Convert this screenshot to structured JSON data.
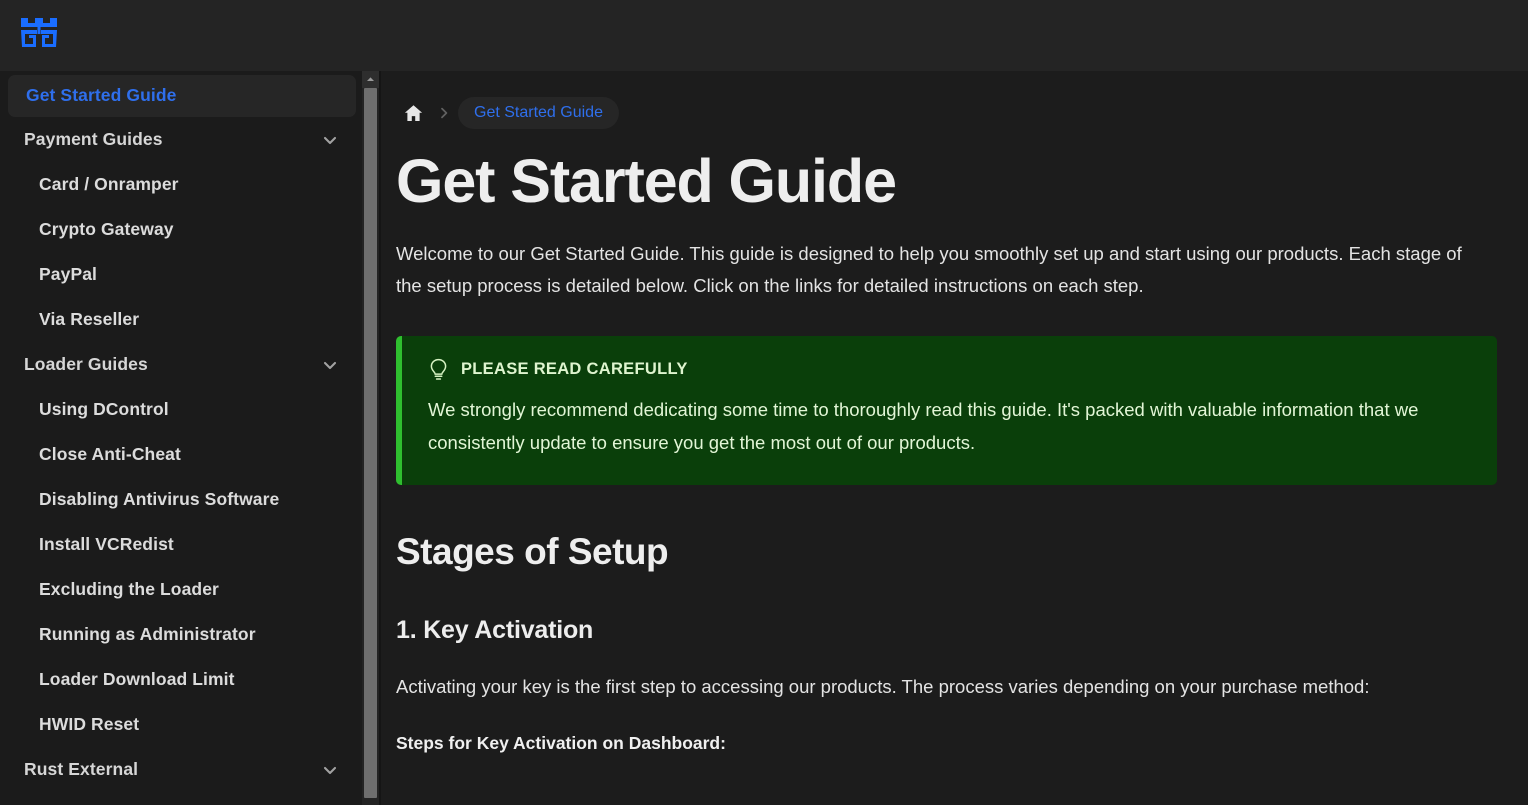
{
  "header": {
    "logo_icon": "brand-logo-icon",
    "logo_color": "#1a6dff"
  },
  "sidebar": {
    "items": [
      {
        "label": "Get Started Guide",
        "level": "top",
        "active": true,
        "expandable": false
      },
      {
        "label": "Payment Guides",
        "level": "top",
        "active": false,
        "expandable": true
      },
      {
        "label": "Card / Onramper",
        "level": "child",
        "active": false,
        "expandable": false
      },
      {
        "label": "Crypto Gateway",
        "level": "child",
        "active": false,
        "expandable": false
      },
      {
        "label": "PayPal",
        "level": "child",
        "active": false,
        "expandable": false
      },
      {
        "label": "Via Reseller",
        "level": "child",
        "active": false,
        "expandable": false
      },
      {
        "label": "Loader Guides",
        "level": "top",
        "active": false,
        "expandable": true
      },
      {
        "label": "Using DControl",
        "level": "child",
        "active": false,
        "expandable": false
      },
      {
        "label": "Close Anti-Cheat",
        "level": "child",
        "active": false,
        "expandable": false
      },
      {
        "label": "Disabling Antivirus Software",
        "level": "child",
        "active": false,
        "expandable": false
      },
      {
        "label": "Install VCRedist",
        "level": "child",
        "active": false,
        "expandable": false
      },
      {
        "label": "Excluding the Loader",
        "level": "child",
        "active": false,
        "expandable": false
      },
      {
        "label": "Running as Administrator",
        "level": "child",
        "active": false,
        "expandable": false
      },
      {
        "label": "Loader Download Limit",
        "level": "child",
        "active": false,
        "expandable": false
      },
      {
        "label": "HWID Reset",
        "level": "child",
        "active": false,
        "expandable": false
      },
      {
        "label": "Rust External",
        "level": "top",
        "active": false,
        "expandable": true
      }
    ],
    "scrollbar": {
      "up_arrow_icon": "scroll-up-arrow-icon"
    },
    "active_color": "#2f6fec"
  },
  "breadcrumb": {
    "home_icon": "home-icon",
    "separator_icon": "chevron-right-icon",
    "current": "Get Started Guide"
  },
  "main": {
    "title": "Get Started Guide",
    "intro": "Welcome to our Get Started Guide. This guide is designed to help you smoothly set up and start using our products. Each stage of the setup process is detailed below. Click on the links for detailed instructions on each step.",
    "callout": {
      "icon": "lightbulb-icon",
      "title": "PLEASE READ CAREFULLY",
      "text": "We strongly recommend dedicating some time to thoroughly read this guide. It's packed with valuable information that we consistently update to ensure you get the most out of our products.",
      "accent_color": "#2fbf2f",
      "background_color": "#0a3f0a"
    },
    "section_heading": "Stages of Setup",
    "subsection_heading": "1. Key Activation",
    "subsection_text": "Activating your key is the first step to accessing our products. The process varies depending on your purchase method:",
    "steps_heading": "Steps for Key Activation on Dashboard:"
  }
}
